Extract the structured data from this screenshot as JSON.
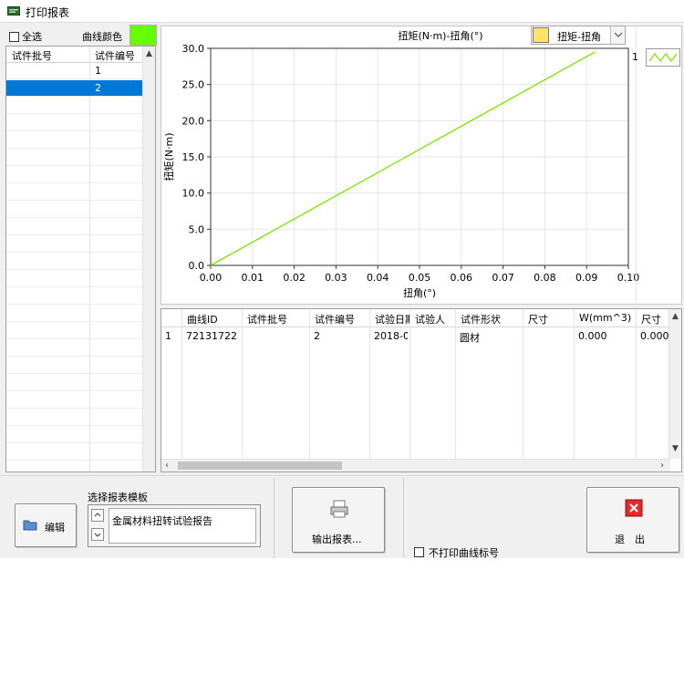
{
  "window": {
    "title": "打印报表"
  },
  "left": {
    "select_all_label": "全选",
    "curve_color_label": "曲线颜色",
    "curve_color": "#66ff00",
    "columns": [
      "试件批号",
      "试件编号"
    ],
    "rows": [
      {
        "batch": "",
        "number": "1",
        "selected": false
      },
      {
        "batch": "",
        "number": "2",
        "selected": true
      }
    ]
  },
  "chart": {
    "selector_label": "扭矩-扭角",
    "legend_index": "1"
  },
  "chart_data": {
    "type": "line",
    "title": "扭矩(N·m)-扭角(°)",
    "xlabel": "扭角(°)",
    "ylabel": "扭矩(N·m)",
    "xlim": [
      0,
      0.1
    ],
    "ylim": [
      0,
      30
    ],
    "xticks": [
      "0.00",
      "0.01",
      "0.02",
      "0.03",
      "0.04",
      "0.05",
      "0.06",
      "0.07",
      "0.08",
      "0.09",
      "0.10"
    ],
    "yticks": [
      "0.0",
      "5.0",
      "10.0",
      "15.0",
      "20.0",
      "25.0",
      "30.0"
    ],
    "grid": true,
    "series": [
      {
        "color": "#7fe000",
        "x": [
          0,
          0.092
        ],
        "y": [
          0,
          29.5
        ]
      }
    ]
  },
  "table": {
    "columns": [
      "曲线ID",
      "试件批号",
      "试件编号",
      "试验日期",
      "试验人",
      "试件形状",
      "尺寸",
      "W(mm^3)",
      "尺寸"
    ],
    "rows": [
      {
        "index": "1",
        "cells": [
          "72131722",
          "",
          "2",
          "2018-0",
          "",
          "圆材",
          "",
          "0.000",
          "0.000"
        ]
      }
    ]
  },
  "controls": {
    "edit_label": "编辑",
    "template_label": "选择报表模板",
    "template_value": "金属材料扭转试验报告",
    "export_label": "输出报表...",
    "no_print_label": "不打印曲线标号",
    "exit_label": "退　出"
  }
}
